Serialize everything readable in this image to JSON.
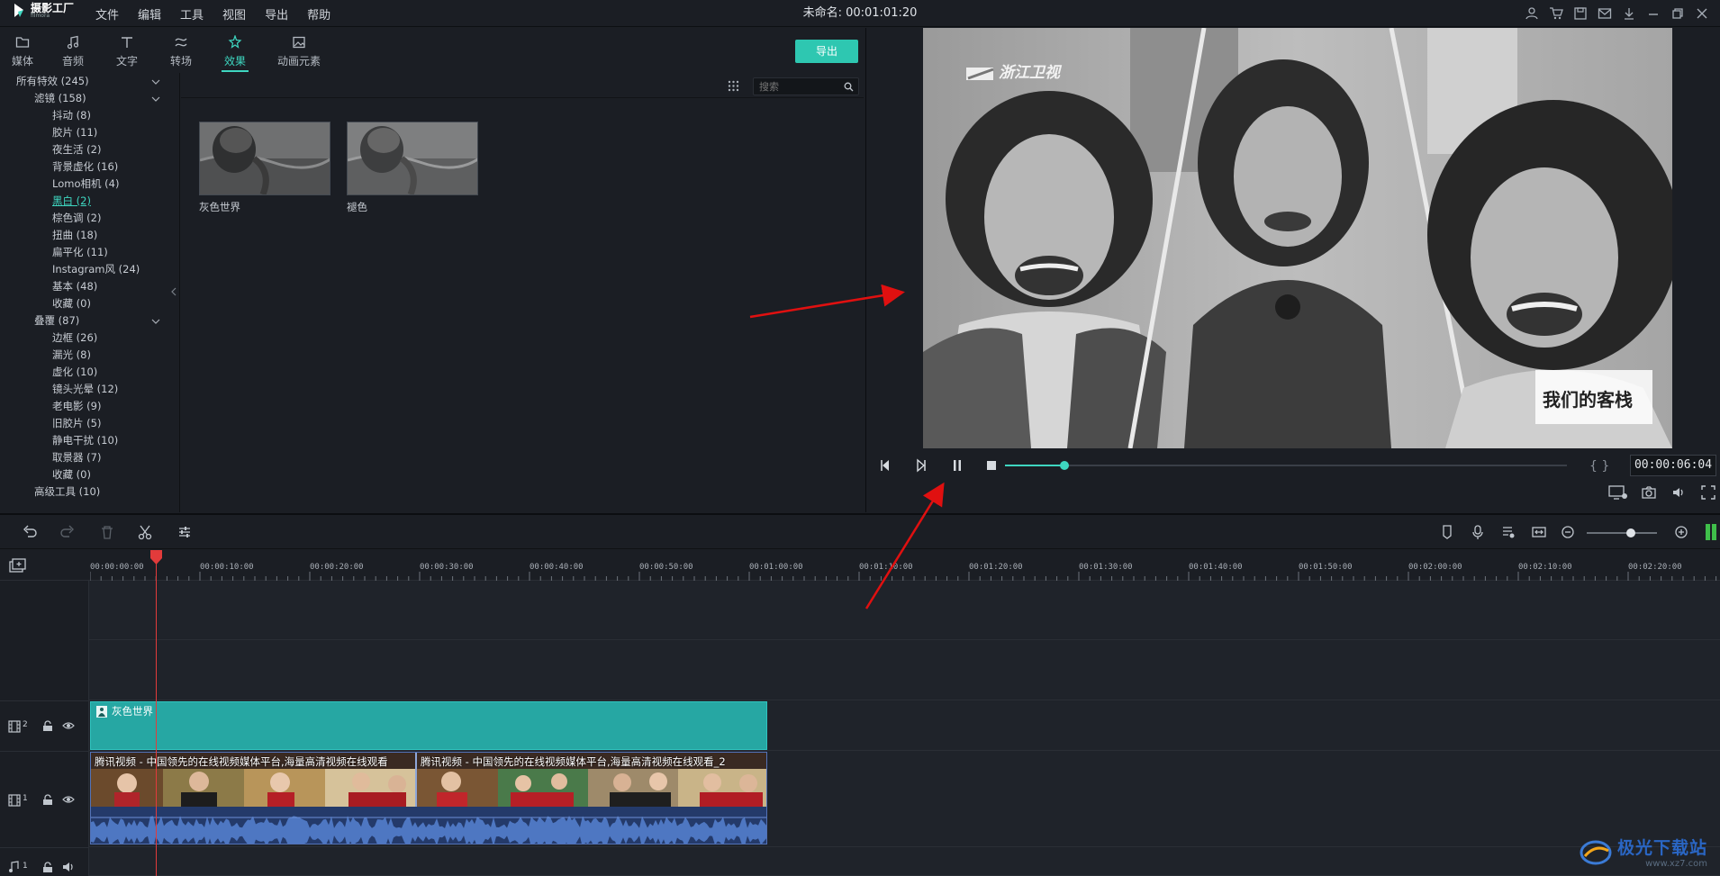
{
  "app": {
    "logo_name": "摄影工厂",
    "logo_sub": "filmora",
    "document_title": "未命名: 00:01:01:20"
  },
  "menu": [
    "文件",
    "编辑",
    "工具",
    "视图",
    "导出",
    "帮助"
  ],
  "title_icons": [
    "user-icon",
    "cart-icon",
    "save-icon",
    "mail-icon",
    "download-icon",
    "minimize-icon",
    "restore-icon",
    "close-icon"
  ],
  "tabs": [
    {
      "label": "媒体",
      "icon": "folder-icon"
    },
    {
      "label": "音频",
      "icon": "music-note-icon"
    },
    {
      "label": "文字",
      "icon": "text-icon"
    },
    {
      "label": "转场",
      "icon": "transition-icon"
    },
    {
      "label": "效果",
      "icon": "effects-icon",
      "active": true
    },
    {
      "label": "动画元素",
      "icon": "image-icon"
    }
  ],
  "export_button": "导出",
  "tree": {
    "root": "所有特效 (245)",
    "filters_group": "滤镜 (158)",
    "filters": [
      "抖动 (8)",
      "胶片 (11)",
      "夜生活 (2)",
      "背景虚化 (16)",
      "Lomo相机 (4)",
      "黑白 (2)",
      "棕色调 (2)",
      "扭曲 (18)",
      "扁平化 (11)",
      "Instagram风 (24)",
      "基本 (48)",
      "收藏 (0)"
    ],
    "selected_filter": "黑白 (2)",
    "overlay_group": "叠覆 (87)",
    "overlays": [
      "边框 (26)",
      "漏光 (8)",
      "虚化 (10)",
      "镜头光晕 (12)",
      "老电影 (9)",
      "旧胶片 (5)",
      "静电干扰 (10)",
      "取景器 (7)",
      "收藏 (0)"
    ],
    "advanced": "高级工具 (10)"
  },
  "search": {
    "placeholder": "搜索"
  },
  "effects": [
    {
      "label": "灰色世界"
    },
    {
      "label": "褪色"
    }
  ],
  "preview": {
    "channel_logo": "浙江卫视",
    "show_logo": "我们的客栈",
    "timecode": "00:00:06:04",
    "progress": 0.1
  },
  "ruler_labels": [
    "00:00:00:00",
    "00:00:10:00",
    "00:00:20:00",
    "00:00:30:00",
    "00:00:40:00",
    "00:00:50:00",
    "00:01:00:00",
    "00:01:10:00",
    "00:01:20:00",
    "00:01:30:00",
    "00:01:40:00",
    "00:01:50:00",
    "00:02:00:00",
    "00:02:10:00",
    "00:02:20:00"
  ],
  "tracks": {
    "track2_label": "2",
    "track1_label": "1",
    "audio1_label": "1",
    "fx_clip_label": "灰色世界",
    "video_clip_1": "腾讯视频 - 中国领先的在线视频媒体平台,海量高清视频在线观看",
    "video_clip_2": "腾讯视频 - 中国领先的在线视频媒体平台,海量高清视频在线观看_2"
  },
  "watermark": {
    "text": "极光下载站",
    "url": "www.xz7.com"
  },
  "colors": {
    "accent": "#3ed6c0",
    "export": "#2ec7b1",
    "fx_clip": "#26a7a3",
    "playhead": "#e23b3b",
    "arrow": "#e01010"
  }
}
